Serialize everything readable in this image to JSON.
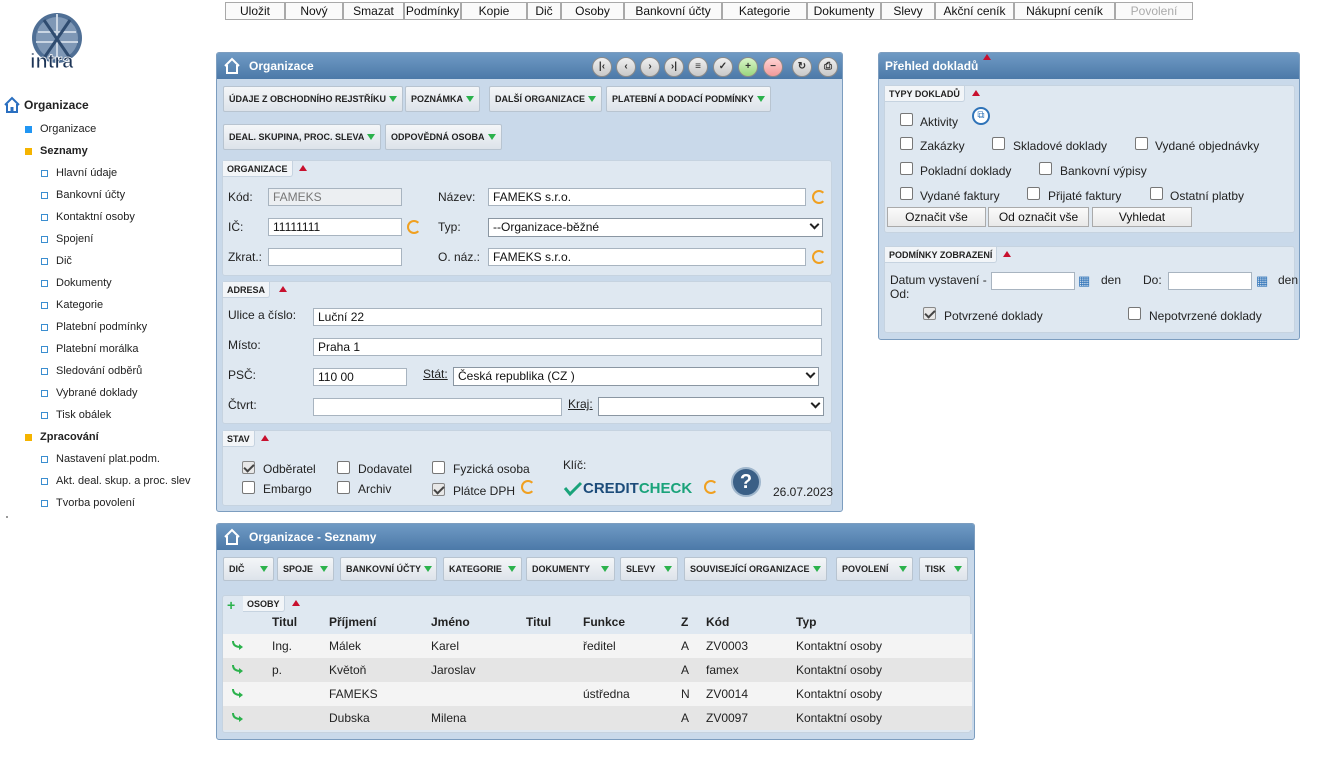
{
  "toolbar": {
    "items": [
      {
        "label": "Uložit",
        "enabled": true
      },
      {
        "label": "Nový",
        "enabled": true
      },
      {
        "label": "Smazat",
        "enabled": true
      },
      {
        "label": "Podmínky",
        "enabled": true
      },
      {
        "label": "Kopie",
        "enabled": true
      },
      {
        "label": "Dič",
        "enabled": true
      },
      {
        "label": "Osoby",
        "enabled": true
      },
      {
        "label": "Bankovní účty",
        "enabled": true
      },
      {
        "label": "Kategorie",
        "enabled": true
      },
      {
        "label": "Dokumenty",
        "enabled": true
      },
      {
        "label": "Slevy",
        "enabled": true
      },
      {
        "label": "Akční ceník",
        "enabled": true
      },
      {
        "label": "Nákupní ceník",
        "enabled": true
      },
      {
        "label": "Povolení",
        "enabled": false
      }
    ]
  },
  "sidebar": {
    "root": "Organizace",
    "items": [
      {
        "label": "Organizace",
        "kind": "page"
      },
      {
        "label": "Seznamy",
        "kind": "folder"
      },
      {
        "label": "Hlavní údaje",
        "kind": "item"
      },
      {
        "label": "Bankovní účty",
        "kind": "item"
      },
      {
        "label": "Kontaktní osoby",
        "kind": "item"
      },
      {
        "label": "Spojení",
        "kind": "item"
      },
      {
        "label": "Dič",
        "kind": "item"
      },
      {
        "label": "Dokumenty",
        "kind": "item"
      },
      {
        "label": "Kategorie",
        "kind": "item"
      },
      {
        "label": "Platební podmínky",
        "kind": "item"
      },
      {
        "label": "Platební morálka",
        "kind": "item"
      },
      {
        "label": "Sledování odběrů",
        "kind": "item"
      },
      {
        "label": "Vybrané doklady",
        "kind": "item"
      },
      {
        "label": "Tisk obálek",
        "kind": "item"
      },
      {
        "label": "Zpracování",
        "kind": "folder"
      },
      {
        "label": "Nastavení plat.podm.",
        "kind": "item"
      },
      {
        "label": "Akt. deal. skup. a proc. slev",
        "kind": "item"
      },
      {
        "label": "Tvorba povolení",
        "kind": "item"
      }
    ]
  },
  "org_panel": {
    "title": "Organizace",
    "tabs": [
      "ÚDAJE Z OBCHODNÍHO REJSTŘÍKU",
      "POZNÁMKA",
      "DALŠÍ ORGANIZACE",
      "PLATEBNÍ A DODACÍ PODMÍNKY",
      "DEAL. SKUPINA, PROC. SLEVA",
      "ODPOVĚDNÁ OSOBA"
    ],
    "org_section": {
      "title": "ORGANIZACE",
      "kod_label": "Kód:",
      "kod_value": "FAMEKS",
      "nazev_label": "Název:",
      "nazev_value": "FAMEKS s.r.o.",
      "ic_label": "IČ:",
      "ic_value": "11111111",
      "typ_label": "Typ:",
      "typ_value": "--Organizace-běžné",
      "zkrat_label": "Zkrat.:",
      "zkrat_value": "",
      "onaz_label": "O. náz.:",
      "onaz_value": "FAMEKS s.r.o."
    },
    "address_section": {
      "title": "ADRESA",
      "ulice_label": "Ulice a číslo:",
      "ulice_value": "Luční 22",
      "misto_label": "Místo:",
      "misto_value": "Praha 1",
      "psc_label": "PSČ:",
      "psc_value": "110 00",
      "stat_label": "Stát:",
      "stat_value": "Česká republika (CZ )",
      "ctvrt_label": "Čtvrt:",
      "ctvrt_value": "",
      "kraj_label": "Kraj:",
      "kraj_value": ""
    },
    "status_section": {
      "title": "STAV",
      "odberatel": {
        "label": "Odběratel",
        "checked": true
      },
      "dodavatel": {
        "label": "Dodavatel",
        "checked": false
      },
      "fyzicka": {
        "label": "Fyzická osoba",
        "checked": false
      },
      "embargo": {
        "label": "Embargo",
        "checked": false
      },
      "archiv": {
        "label": "Archiv",
        "checked": false
      },
      "platce": {
        "label": "Plátce DPH",
        "checked": true
      },
      "klic_label": "Klíč:",
      "creditcheck_a": "CREDIT",
      "creditcheck_b": "CHECK",
      "date": "26.07.2023"
    }
  },
  "doc_panel": {
    "title": "Přehled dokladů",
    "types_title": "TYPY DOKLADŮ",
    "types": {
      "aktivity": "Aktivity",
      "zakazky": "Zakázky",
      "skladove": "Skladové doklady",
      "vydane_obj": "Vydané objednávky",
      "pokladni": "Pokladní doklady",
      "bankovni": "Bankovní výpisy",
      "vydane_fakt": "Vydané faktury",
      "prijate_fakt": "Přijaté faktury",
      "ostatni": "Ostatní platby"
    },
    "buttons": {
      "select_all": "Označit vše",
      "deselect_all": "Od označit vše",
      "search": "Vyhledat"
    },
    "conditions_title": "PODMÍNKY ZOBRAZENÍ",
    "date_from_label_1": "Datum vystavení -",
    "date_from_label_2": "Od:",
    "den1": "den",
    "date_to_label": "Do:",
    "den2": "den",
    "confirmed": {
      "label": "Potvrzené doklady",
      "checked": true
    },
    "unconfirmed": {
      "label": "Nepotvrzené doklady",
      "checked": false
    }
  },
  "lists_panel": {
    "title": "Organizace - Seznamy",
    "tabs": [
      "DIČ",
      "SPOJE",
      "BANKOVNÍ ÚČTY",
      "KATEGORIE",
      "DOKUMENTY",
      "SLEVY",
      "SOUVISEJÍCÍ ORGANIZACE",
      "POVOLENÍ",
      "TISK"
    ],
    "section_title": "OSOBY",
    "columns": [
      "Titul",
      "Příjmení",
      "Jméno",
      "Titul",
      "Funkce",
      "Z",
      "Kód",
      "Typ"
    ],
    "rows": [
      [
        "Ing.",
        "Málek",
        "Karel",
        "",
        "ředitel",
        "A",
        "ZV0003",
        "Kontaktní osoby"
      ],
      [
        "p.",
        "Květoň",
        "Jaroslav",
        "",
        "",
        "A",
        "famex",
        "Kontaktní osoby"
      ],
      [
        "",
        "FAMEKS",
        "",
        "",
        "ústředna",
        "N",
        "ZV0014",
        "Kontaktní osoby"
      ],
      [
        "",
        "Dubska",
        "Milena",
        "",
        "",
        "A",
        "ZV0097",
        "Kontaktní osoby"
      ]
    ]
  },
  "colors": {
    "header": "#5a86b4",
    "panel": "#c9d9ea",
    "accent_green": "#2bb24c",
    "accent_red": "#c8102e"
  }
}
